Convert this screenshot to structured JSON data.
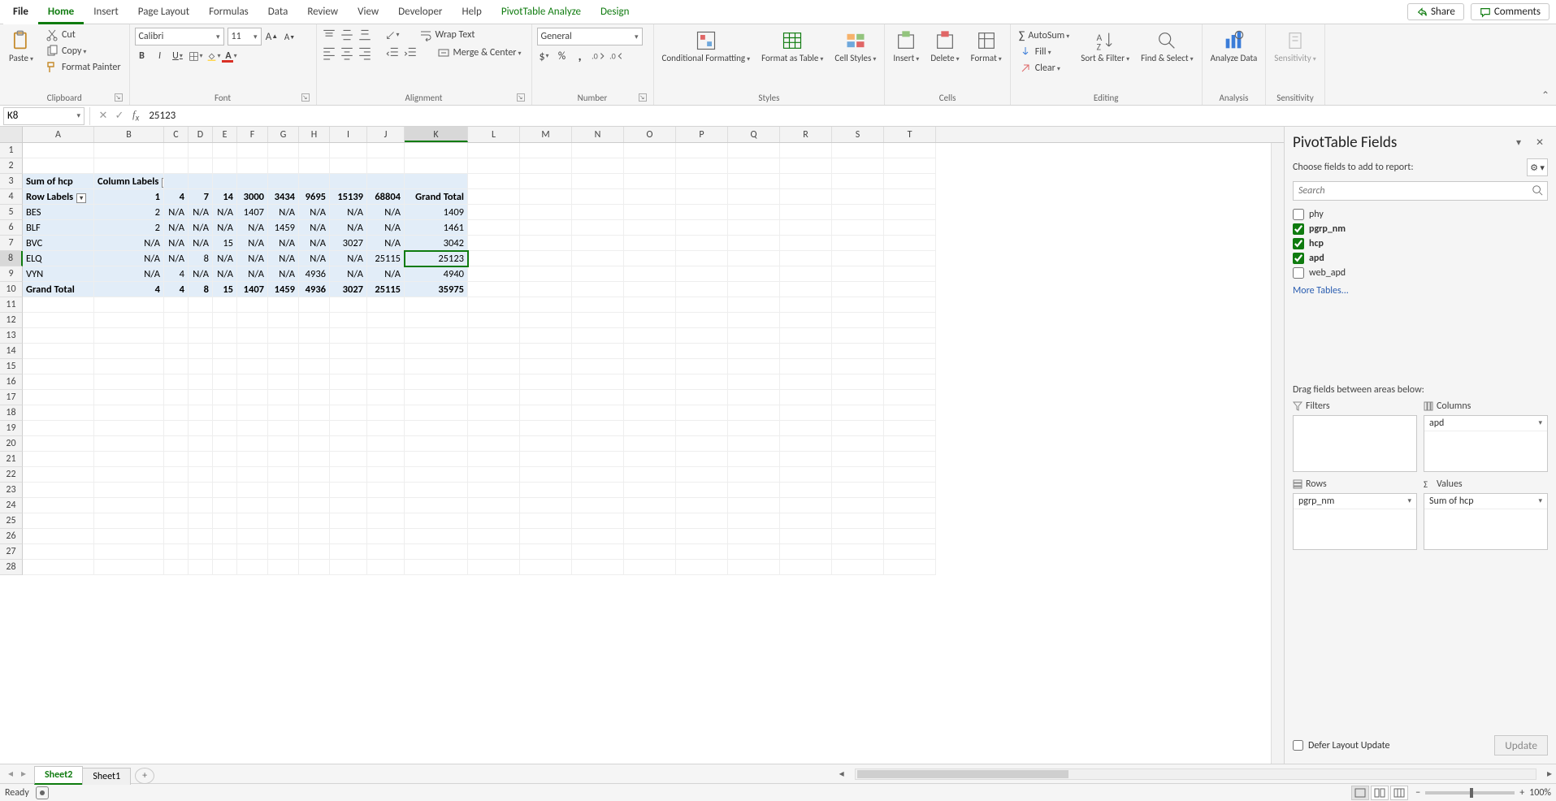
{
  "tabs": {
    "file": "File",
    "home": "Home",
    "insert": "Insert",
    "page_layout": "Page Layout",
    "formulas": "Formulas",
    "data": "Data",
    "review": "Review",
    "view": "View",
    "developer": "Developer",
    "help": "Help",
    "pt_analyze": "PivotTable Analyze",
    "design": "Design",
    "share": "Share",
    "comments": "Comments"
  },
  "ribbon": {
    "clipboard": {
      "paste": "Paste",
      "cut": "Cut",
      "copy": "Copy",
      "format_painter": "Format Painter",
      "label": "Clipboard"
    },
    "font": {
      "name": "Calibri",
      "size": "11",
      "label": "Font",
      "bold": "B",
      "italic": "I",
      "underline": "U"
    },
    "alignment": {
      "wrap": "Wrap Text",
      "merge": "Merge & Center",
      "label": "Alignment"
    },
    "number": {
      "format": "General",
      "label": "Number"
    },
    "styles": {
      "cond": "Conditional Formatting",
      "fat": "Format as Table",
      "cell": "Cell Styles",
      "label": "Styles"
    },
    "cells": {
      "insert": "Insert",
      "delete": "Delete",
      "format": "Format",
      "label": "Cells"
    },
    "editing": {
      "autosum": "AutoSum",
      "fill": "Fill",
      "clear": "Clear",
      "sort": "Sort & Filter",
      "find": "Find & Select",
      "label": "Editing"
    },
    "analysis": {
      "analyze": "Analyze Data",
      "label": "Analysis"
    },
    "sensitivity": {
      "btn": "Sensitivity",
      "label": "Sensitivity"
    }
  },
  "namebox": "K8",
  "formula": "25123",
  "grid": {
    "columns": [
      "A",
      "B",
      "C",
      "D",
      "E",
      "F",
      "G",
      "H",
      "I",
      "J",
      "K",
      "L",
      "M",
      "N",
      "O",
      "P",
      "Q",
      "R",
      "S",
      "T"
    ],
    "rows": [
      "1",
      "2",
      "3",
      "4",
      "5",
      "6",
      "7",
      "8",
      "9",
      "10",
      "11",
      "12",
      "13",
      "14",
      "15",
      "16",
      "17",
      "18",
      "19",
      "20",
      "21",
      "22",
      "23",
      "24",
      "25",
      "26",
      "27",
      "28"
    ],
    "pivot": {
      "sum_label": "Sum of hcp",
      "col_labels": "Column Labels",
      "row_labels": "Row Labels",
      "col_values": [
        "1",
        "4",
        "7",
        "14",
        "3000",
        "3434",
        "9695",
        "15139",
        "68804",
        "Grand Total"
      ],
      "rows": [
        {
          "label": "BES",
          "vals": [
            "2",
            "N/A",
            "N/A",
            "N/A",
            "1407",
            "N/A",
            "N/A",
            "N/A",
            "N/A",
            "1409"
          ]
        },
        {
          "label": "BLF",
          "vals": [
            "2",
            "N/A",
            "N/A",
            "N/A",
            "N/A",
            "1459",
            "N/A",
            "N/A",
            "N/A",
            "1461"
          ]
        },
        {
          "label": "BVC",
          "vals": [
            "N/A",
            "N/A",
            "N/A",
            "15",
            "N/A",
            "N/A",
            "N/A",
            "3027",
            "N/A",
            "3042"
          ]
        },
        {
          "label": "ELQ",
          "vals": [
            "N/A",
            "N/A",
            "8",
            "N/A",
            "N/A",
            "N/A",
            "N/A",
            "N/A",
            "25115",
            "25123"
          ]
        },
        {
          "label": "VYN",
          "vals": [
            "N/A",
            "4",
            "N/A",
            "N/A",
            "N/A",
            "N/A",
            "4936",
            "N/A",
            "N/A",
            "4940"
          ]
        }
      ],
      "grand": {
        "label": "Grand Total",
        "vals": [
          "4",
          "4",
          "8",
          "15",
          "1407",
          "1459",
          "4936",
          "3027",
          "25115",
          "35975"
        ]
      }
    }
  },
  "pane": {
    "title": "PivotTable Fields",
    "choose": "Choose fields to add to report:",
    "search_ph": "Search",
    "fields": [
      {
        "name": "phy",
        "checked": false,
        "bold": false
      },
      {
        "name": "pgrp_nm",
        "checked": true,
        "bold": true
      },
      {
        "name": "hcp",
        "checked": true,
        "bold": true
      },
      {
        "name": "apd",
        "checked": true,
        "bold": true
      },
      {
        "name": "web_apd",
        "checked": false,
        "bold": false
      }
    ],
    "more_tables": "More Tables...",
    "drag_label": "Drag fields between areas below:",
    "areas": {
      "filters": {
        "title": "Filters",
        "items": []
      },
      "columns": {
        "title": "Columns",
        "items": [
          "apd"
        ]
      },
      "rows": {
        "title": "Rows",
        "items": [
          "pgrp_nm"
        ]
      },
      "values": {
        "title": "Values",
        "items": [
          "Sum of hcp"
        ]
      }
    },
    "defer": "Defer Layout Update",
    "update": "Update"
  },
  "sheets": {
    "s2": "Sheet2",
    "s1": "Sheet1"
  },
  "status": {
    "ready": "Ready",
    "zoom": "100%"
  }
}
